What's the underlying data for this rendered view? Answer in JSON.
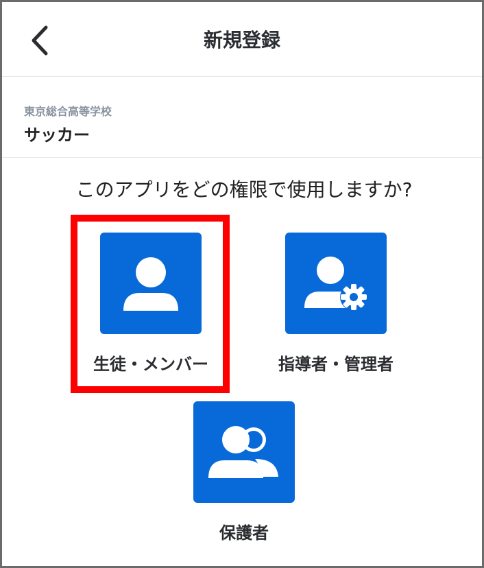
{
  "header": {
    "title": "新規登録",
    "back_icon": "chevron-left-icon"
  },
  "organization": {
    "school_name": "東京総合高等学校",
    "team_name": "サッカー"
  },
  "question": "このアプリをどの権限で使用しますか?",
  "roles": [
    {
      "label": "生徒・メンバー",
      "icon": "person-icon",
      "selected": true
    },
    {
      "label": "指導者・管理者",
      "icon": "person-gear-icon",
      "selected": false
    },
    {
      "label": "保護者",
      "icon": "people-icon",
      "selected": false
    }
  ],
  "colors": {
    "tile": "#086ad8",
    "highlight": "#ff0000"
  }
}
